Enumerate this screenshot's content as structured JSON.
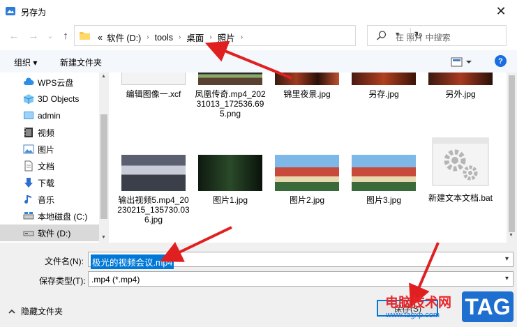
{
  "window": {
    "title": "另存为",
    "close_glyph": "✕"
  },
  "nav": {
    "back_glyph": "←",
    "forward_glyph": "→",
    "recent_glyph": "⌄",
    "up_glyph": "↑",
    "breadcrumb_lead": "«",
    "breadcrumbs": [
      "软件 (D:)",
      "tools",
      "桌面",
      "照片"
    ],
    "separator": "›",
    "refresh_glyph": "↻",
    "search_placeholder": "在 照片 中搜索"
  },
  "toolbar": {
    "organize_label": "组织 ▾",
    "new_folder_label": "新建文件夹",
    "help_label": "?"
  },
  "sidebar": {
    "items": [
      {
        "label": "WPS云盘",
        "icon": "cloud-icon"
      },
      {
        "label": "3D Objects",
        "icon": "cube-icon"
      },
      {
        "label": "admin",
        "icon": "user-icon"
      },
      {
        "label": "视频",
        "icon": "video-icon"
      },
      {
        "label": "图片",
        "icon": "picture-icon"
      },
      {
        "label": "文档",
        "icon": "document-icon"
      },
      {
        "label": "下载",
        "icon": "download-icon"
      },
      {
        "label": "音乐",
        "icon": "music-icon"
      },
      {
        "label": "本地磁盘 (C:)",
        "icon": "drive-icon"
      },
      {
        "label": "软件 (D:)",
        "icon": "drive-icon"
      }
    ],
    "selected_index": 9
  },
  "files": [
    {
      "name": "编辑图像一.xcf"
    },
    {
      "name": "凤凰传奇.mp4_20231013_172536.695.png"
    },
    {
      "name": "锦里夜景.jpg"
    },
    {
      "name": "另存.jpg"
    },
    {
      "name": "另外.jpg"
    },
    {
      "name": "输出视频5.mp4_20230215_135730.036.jpg"
    },
    {
      "name": "图片1.jpg"
    },
    {
      "name": "图片2.jpg"
    },
    {
      "name": "图片3.jpg"
    },
    {
      "name": "新建文本文档.bat"
    }
  ],
  "form": {
    "filename_label": "文件名(N):",
    "filename_value": "极光的视频会议.mp4",
    "type_label": "保存类型(T):",
    "type_value": ".mp4 (*.mp4)",
    "hide_folders_label": "隐藏文件夹",
    "save_label": "保存(S)"
  },
  "watermark": {
    "text_cn": "电脑技术网",
    "text_url": "www.tagxp.com",
    "text_tag": "TAG"
  },
  "colors": {
    "accent": "#0078d7",
    "arrow": "#e02020",
    "watermark_red": "#e8262a",
    "tag_blue": "#1e6fd0"
  }
}
